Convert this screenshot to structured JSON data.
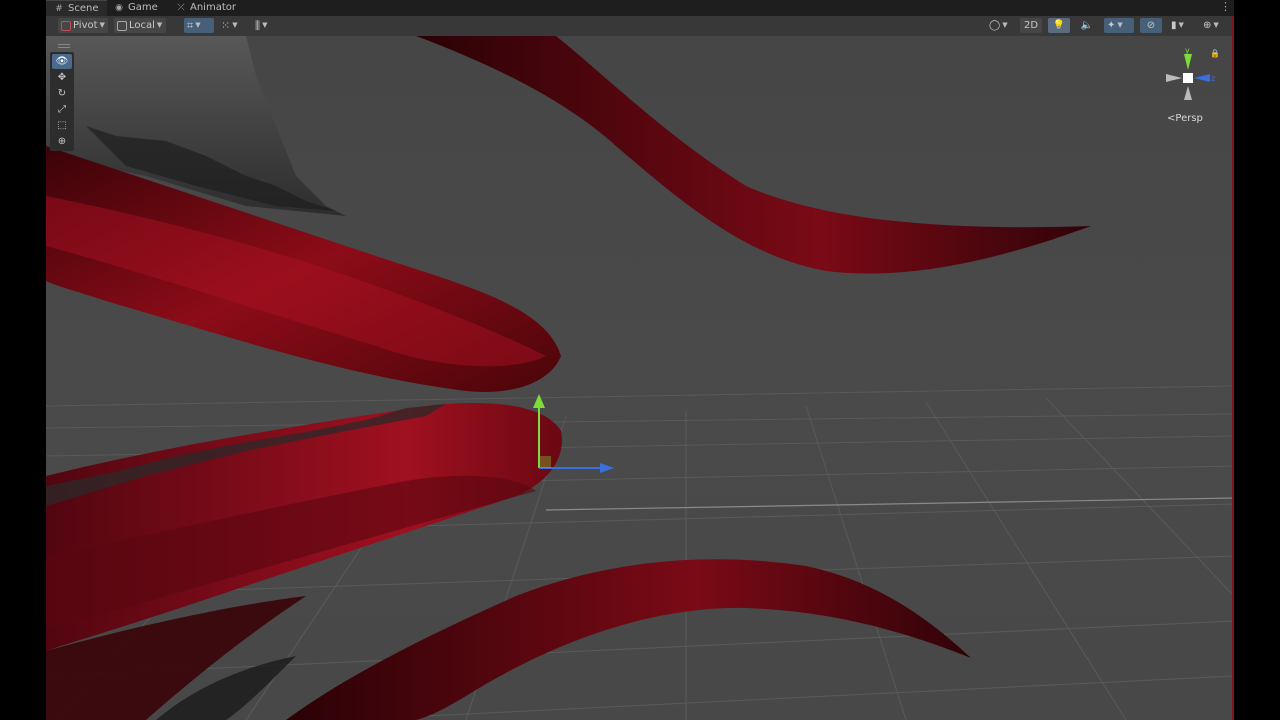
{
  "tabs": [
    {
      "label": "Scene",
      "icon": "grid-icon",
      "active": true
    },
    {
      "label": "Game",
      "icon": "gamepad-icon",
      "active": false
    },
    {
      "label": "Animator",
      "icon": "animator-icon",
      "active": false
    }
  ],
  "tab_menu_icon": "more-vertical-icon",
  "toolbar": {
    "pivot_label": "Pivot",
    "local_label": "Local",
    "two_d_label": "2D"
  },
  "tools": [
    {
      "name": "view-tool",
      "icon": "eye-icon",
      "glyph": "👁"
    },
    {
      "name": "move-tool",
      "icon": "move-arrows-icon",
      "glyph": "✥"
    },
    {
      "name": "rotate-tool",
      "icon": "rotate-icon",
      "glyph": "↻"
    },
    {
      "name": "scale-tool",
      "icon": "scale-icon",
      "glyph": "⤢"
    },
    {
      "name": "rect-tool",
      "icon": "rect-transform-icon",
      "glyph": "⬚"
    },
    {
      "name": "transform-tool",
      "icon": "transform-icon",
      "glyph": "⊕"
    }
  ],
  "gizmo": {
    "y_label": "y",
    "z_label": "z",
    "projection_label": "Persp"
  },
  "colors": {
    "accent_selected": "#4b6b8c",
    "axis_y": "#7ddc3a",
    "axis_x": "#3a6fe0",
    "mesh_red": "#8a0a16",
    "viewport_bg": "#484848"
  }
}
